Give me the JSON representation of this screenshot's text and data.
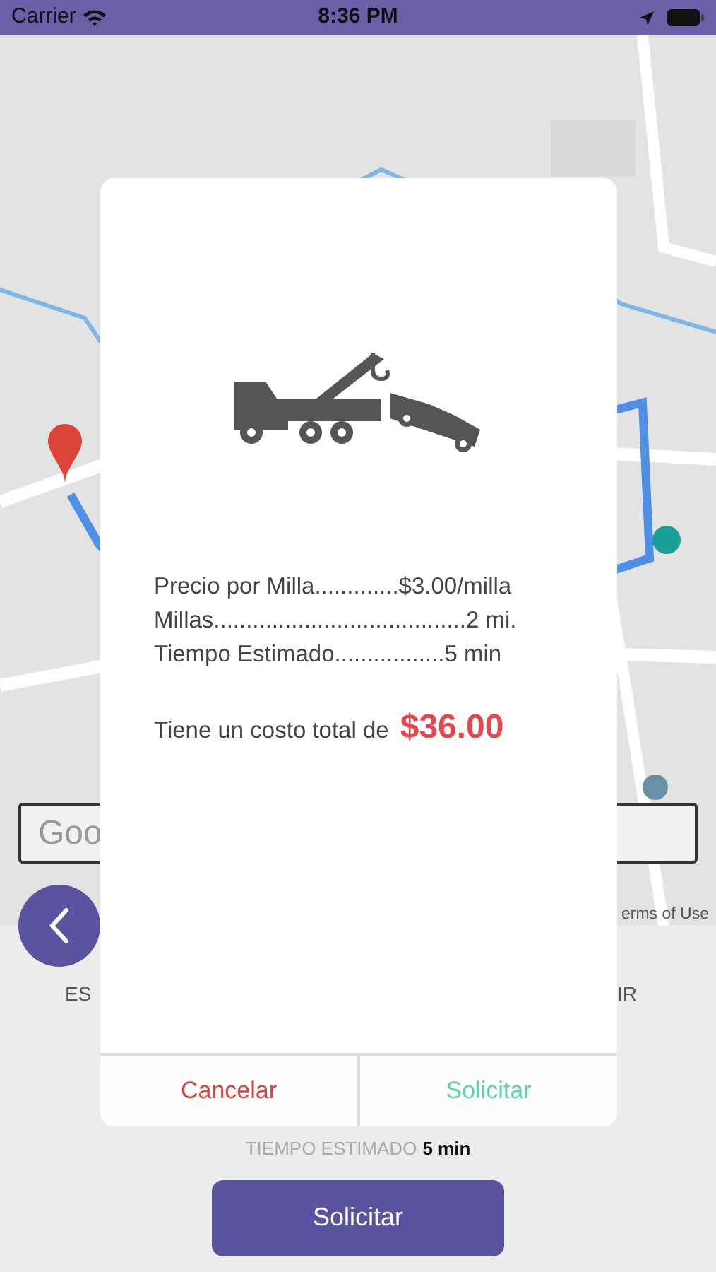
{
  "status_bar": {
    "carrier": "Carrier",
    "time": "8:36 PM"
  },
  "map": {
    "kind": "picture",
    "search": {
      "placeholder": "Goo"
    },
    "attribution": "erms of Use"
  },
  "bottom_labels": [
    "ES",
    "IR"
  ],
  "dialog": {
    "details": [
      "Precio por Milla.............$3.00/milla",
      "Millas.......................................2 mi.",
      "Tiempo Estimado.................5 min"
    ],
    "total_label": "Tiene un costo total de",
    "total_value": "$36.00",
    "buttons": [
      {
        "label": "Cancelar",
        "kind": "cancel"
      },
      {
        "label": "Solicitar",
        "kind": "confirm"
      }
    ]
  },
  "estimate": {
    "label": "TIEMPO ESTIMADO",
    "value": "5 min"
  },
  "request_button": "Solicitar"
}
